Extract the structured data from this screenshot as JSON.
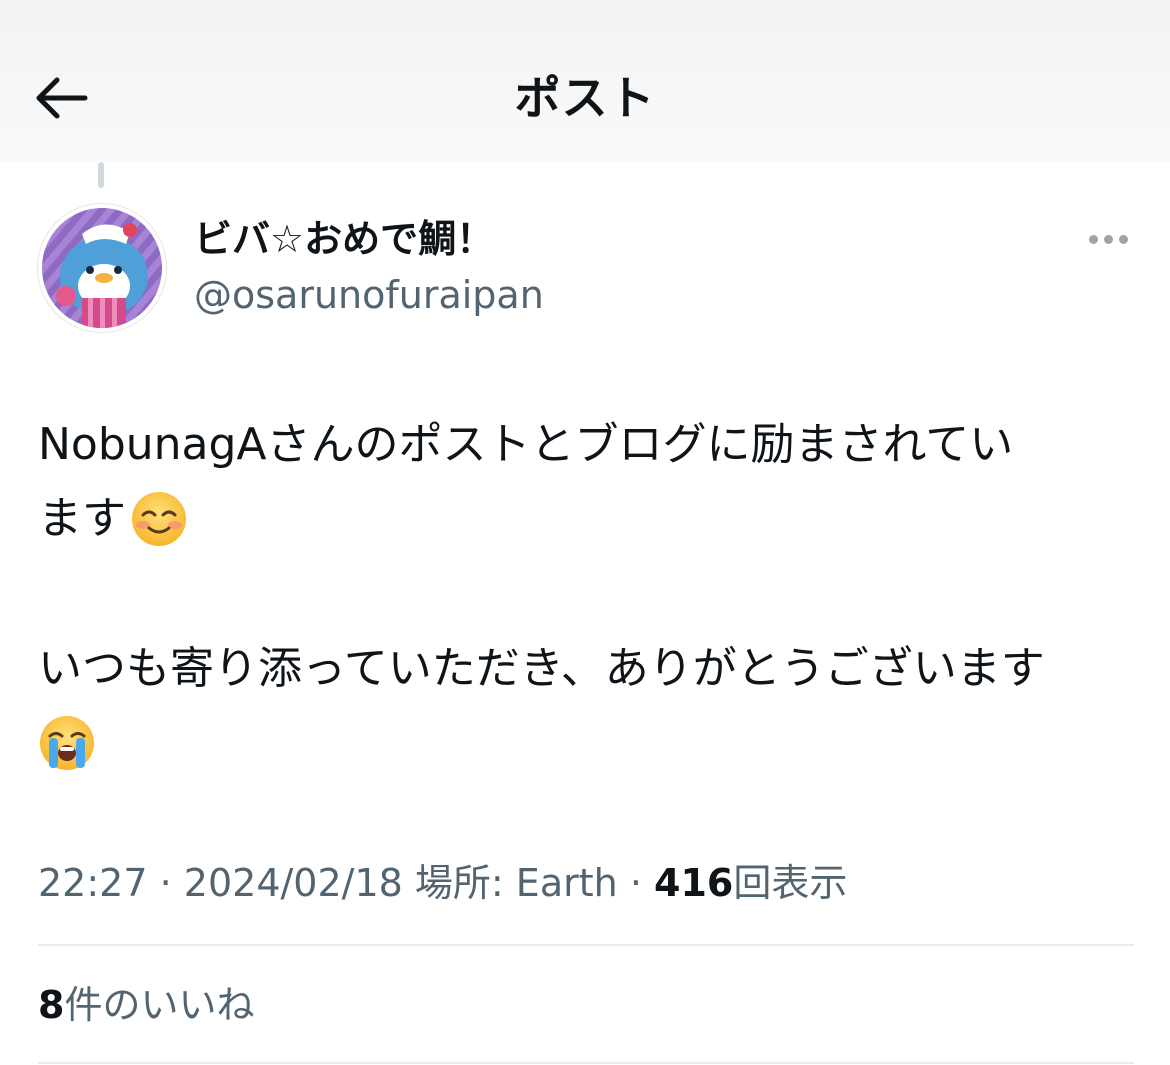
{
  "header": {
    "title": "ポスト",
    "back_icon": "arrow-left-icon"
  },
  "post": {
    "author": {
      "display_name": "ビバ☆おめで鯛！",
      "handle": "@osarunofuraipan",
      "avatar": "penguin-character-avatar"
    },
    "more_icon": "more-horizontal-icon",
    "text_lines": [
      "NobunagAさんのポストとブログに励まされてい",
      "ます",
      "いつも寄り添っていただき、ありがとうございます"
    ],
    "emojis": [
      "smiling-blush-emoji",
      "loudly-crying-emoji"
    ],
    "meta": {
      "time": "22:27",
      "separator": "·",
      "date": "2024/02/18",
      "location": "場所: Earth",
      "views_count": "416",
      "views_label": "回表示"
    },
    "likes": {
      "count": "8",
      "label": "件のいいね"
    }
  },
  "colors": {
    "text": "#0f1419",
    "secondary": "#536471",
    "divider": "#e9ecee",
    "thread_line": "#cfd9de"
  }
}
